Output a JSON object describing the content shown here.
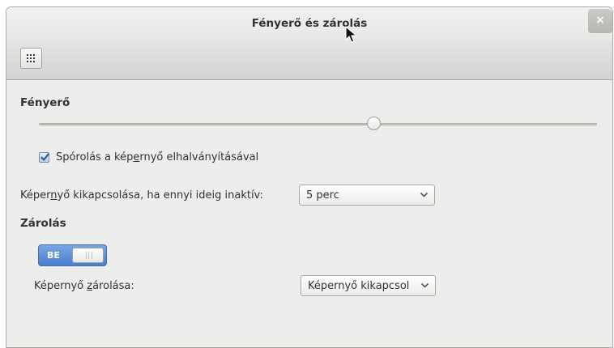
{
  "window": {
    "title": "Fényerő és zárolás",
    "close_glyph": "×"
  },
  "toolbar": {
    "grid_icon": "app-grid-icon"
  },
  "brightness": {
    "heading": "Fényerő",
    "level": 0.6,
    "dim_check": {
      "checked": true,
      "label_pre": "Spórolás a kép",
      "label_mnemonic": "e",
      "label_post": "rnyő elhalványításával"
    },
    "off_row": {
      "label_pre": "Képer",
      "label_mnemonic": "n",
      "label_post": "yő kikapcsolása, ha ennyi ideig inaktív:",
      "value": "5 perc"
    }
  },
  "lock": {
    "heading": "Zárolás",
    "switch_on_label": "BE",
    "switch_state": true,
    "screen_lock_row": {
      "label_pre": "Képernyő ",
      "label_mnemonic": "z",
      "label_post": "árolása:",
      "value": "Képernyő kikapcsol"
    }
  },
  "colors": {
    "accent": "#4a7fd0",
    "window_bg": "#ededeb"
  }
}
